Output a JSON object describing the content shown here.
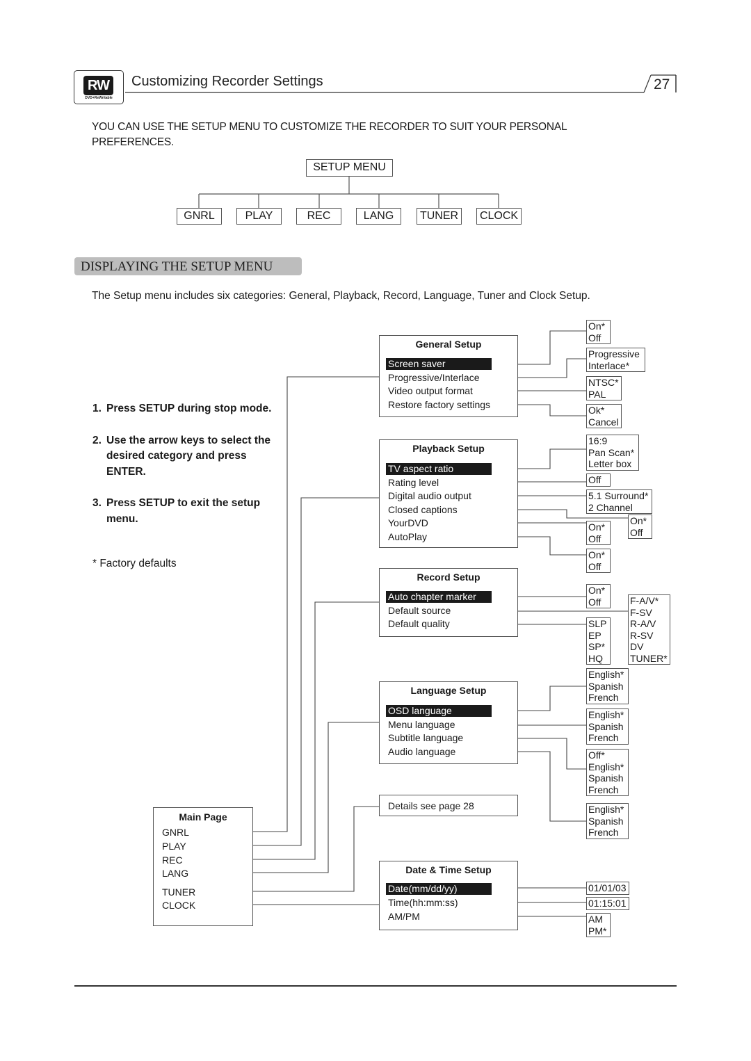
{
  "header": {
    "logo_text": "RW",
    "logo_subtext": "DVD+ReWritable",
    "title": "Customizing Recorder Settings",
    "page_number": "27"
  },
  "intro_text": "YOU CAN USE THE SETUP MENU TO CUSTOMIZE THE RECORDER TO SUIT YOUR PERSONAL PREFERENCES.",
  "menu_tree": {
    "root": "SETUP MENU",
    "children": [
      "GNRL",
      "PLAY",
      "REC",
      "LANG",
      "TUNER",
      "CLOCK"
    ]
  },
  "section_heading": "DISPLAYING THE SETUP MENU",
  "section_description": "The Setup menu includes six categories: General, Playback, Record, Language, Tuner and Clock Setup.",
  "steps": [
    {
      "num": "1.",
      "text": "Press SETUP during stop mode."
    },
    {
      "num": "2.",
      "text": "Use the arrow keys to select the desired category and press  ENTER."
    },
    {
      "num": "3.",
      "text": "Press SETUP to exit the setup menu."
    }
  ],
  "footnote": "* Factory defaults",
  "main_page": {
    "title": "Main Page",
    "items": [
      "GNRL",
      "PLAY",
      "REC",
      "LANG",
      "TUNER",
      "CLOCK"
    ]
  },
  "panels": {
    "general": {
      "title": "General Setup",
      "items": [
        "Screen saver",
        "Progressive/Interlace",
        "Video output format",
        "Restore factory settings"
      ],
      "options": [
        [
          "On*",
          "Off"
        ],
        [
          "Progressive",
          "Interlace*"
        ],
        [
          "NTSC*",
          "PAL"
        ],
        [
          "Ok*",
          "Cancel"
        ]
      ]
    },
    "playback": {
      "title": "Playback Setup",
      "items": [
        "TV aspect ratio",
        "Rating level",
        "Digital audio output",
        "Closed captions",
        "YourDVD",
        "AutoPlay"
      ],
      "options": [
        [
          "16:9",
          "Pan Scan*",
          "Letter box"
        ],
        [
          "Off"
        ],
        [
          "5.1 Surround*",
          "2 Channel"
        ],
        [
          "On*",
          "Off"
        ],
        [
          "On*",
          "Off"
        ],
        [
          "On*",
          "Off"
        ]
      ]
    },
    "record": {
      "title": "Record Setup",
      "items": [
        "Auto chapter marker",
        "Default source",
        "Default quality"
      ],
      "options": [
        [
          "On*",
          "Off"
        ],
        [
          "F-A/V*",
          "F-SV",
          "R-A/V",
          "R-SV",
          "DV",
          "TUNER*"
        ],
        [
          "SLP",
          "EP",
          "SP*",
          "HQ"
        ]
      ]
    },
    "language": {
      "title": "Language Setup",
      "items": [
        "OSD language",
        "Menu language",
        "Subtitle language",
        "Audio language"
      ],
      "options": [
        [
          "English*",
          "Spanish",
          "French"
        ],
        [
          "English*",
          "Spanish",
          "French"
        ],
        [
          "Off*",
          "English*",
          "Spanish",
          "French"
        ],
        [
          "English*",
          "Spanish",
          "French"
        ]
      ]
    },
    "tuner": {
      "text": "Details see page 28"
    },
    "clock": {
      "title": "Date & Time Setup",
      "items": [
        "Date(mm/dd/yy)",
        "Time(hh:mm:ss)",
        "AM/PM"
      ],
      "options": [
        [
          "01/01/03"
        ],
        [
          "01:15:01"
        ],
        [
          "AM",
          "PM*"
        ]
      ]
    }
  }
}
